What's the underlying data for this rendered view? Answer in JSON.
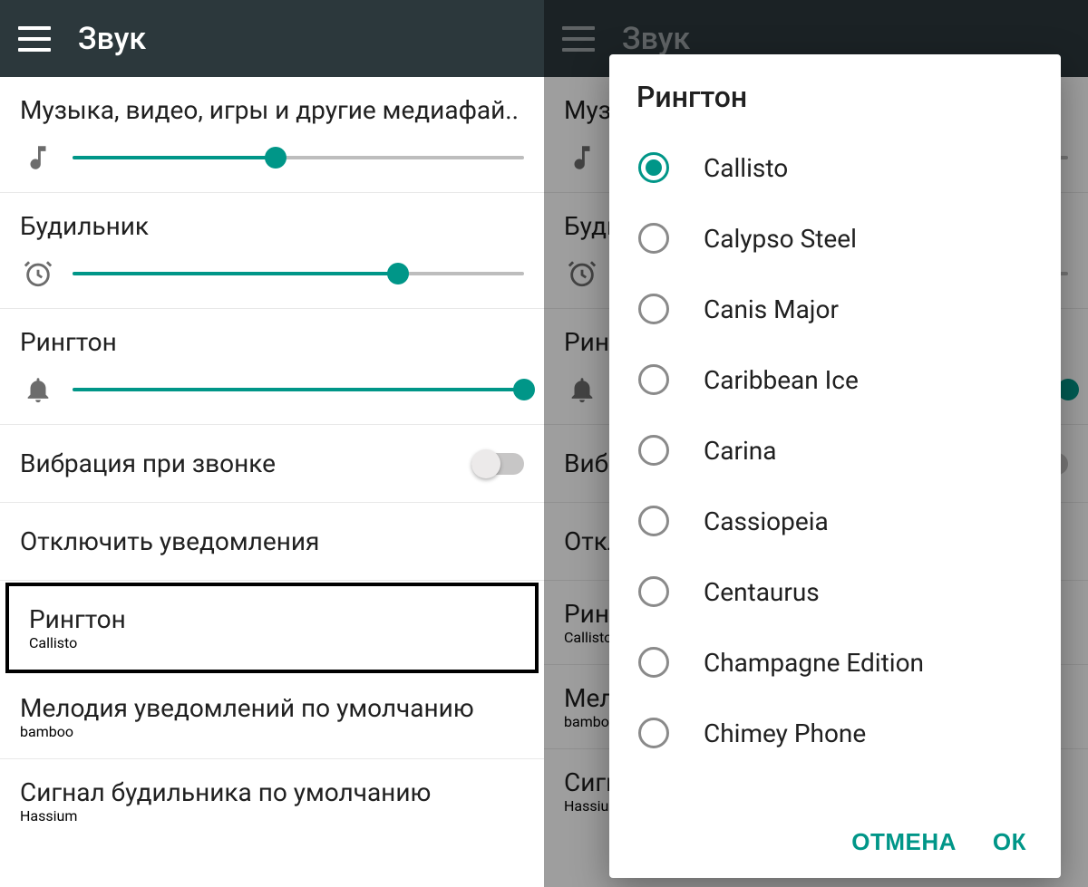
{
  "left": {
    "appbar_title": "Звук",
    "media": {
      "label": "Музыка, видео, игры и другие медиафай..",
      "value": 45
    },
    "alarm": {
      "label": "Будильник",
      "value": 72
    },
    "ringtone_volume": {
      "label": "Рингтон",
      "value": 100
    },
    "vibrate": {
      "label": "Вибрация при звонке",
      "on": false
    },
    "dnd": {
      "label": "Отключить уведомления"
    },
    "ringtone": {
      "label": "Рингтон",
      "value": "Callisto"
    },
    "notification_sound": {
      "label": "Мелодия уведомлений по умолчанию",
      "value": "bamboo"
    },
    "alarm_sound": {
      "label": "Сигнал будильника по умолчанию",
      "value": "Hassium"
    }
  },
  "right": {
    "appbar_title": "Звук",
    "dialog": {
      "title": "Рингтон",
      "selected": "Callisto",
      "options": [
        "Callisto",
        "Calypso Steel",
        "Canis Major",
        "Caribbean Ice",
        "Carina",
        "Cassiopeia",
        "Centaurus",
        "Champagne Edition",
        "Chimey Phone"
      ],
      "cancel_label": "ОТМЕНА",
      "ok_label": "ОК"
    }
  }
}
